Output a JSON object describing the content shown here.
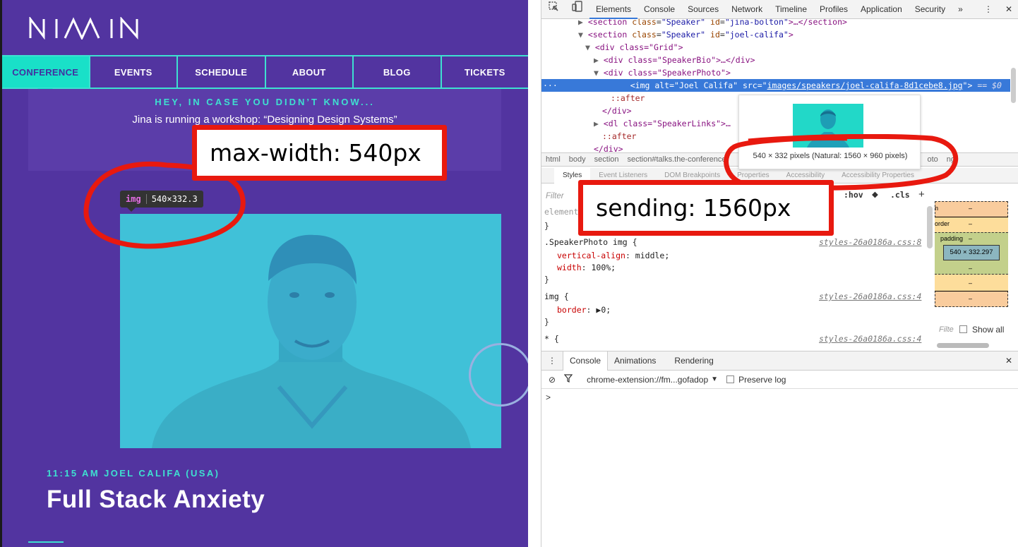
{
  "site": {
    "logo_text": "MIXIN",
    "nav": [
      "CONFERENCE",
      "EVENTS",
      "SCHEDULE",
      "ABOUT",
      "BLOG",
      "TICKETS"
    ],
    "notice_kicker": "HEY, IN CASE YOU DIDN’T KNOW...",
    "notice_text": "Jina is running a workshop: “Designing Design Systems”",
    "img_tip_tag": "img",
    "img_tip_dims": "540×332.3",
    "talk_meta": "11:15 AM JOEL CALIFA (USA)",
    "talk_title": "Full Stack Anxiety"
  },
  "annotations": {
    "max_width": "max-width: 540px",
    "sending": "sending: 1560px"
  },
  "devtools": {
    "tabs": [
      "Elements",
      "Console",
      "Sources",
      "Network",
      "Timeline",
      "Profiles",
      "Application",
      "Security"
    ],
    "more": "»",
    "dom": {
      "l1_tag": "<section",
      "l1_attr1": "class",
      "l1_val1": "\"Speaker\"",
      "l1_attr2": "id",
      "l1_val2": "\"jina-bolton\"",
      "l1_tail": ">…</section>",
      "l2_tag": "<section",
      "l2_attr1": "class",
      "l2_val1": "\"Speaker\"",
      "l2_attr2": "id",
      "l2_val2": "\"joel-califa\"",
      "l2_tail": ">",
      "l3": "<div class=\"Grid\">",
      "l4": "<div class=\"SpeakerBio\">…</div>",
      "l5": "<div class=\"SpeakerPhoto\">",
      "l6_pre": "<img alt=\"Joel Califa\" src=\"",
      "l6_src": "images/speakers/joel-califa-8d1cebe8.jpg",
      "l6_post": "\">",
      "l6_eq": "== $0",
      "l6_dots": "···",
      "l7": "::after",
      "l8": "</div>",
      "l9": "<dl class=\"SpeakerLinks\">…",
      "l10": "::after",
      "l11": "</div>"
    },
    "preview_dims": "540 × 332 pixels (Natural: 1560 × 960 pixels)",
    "breadcrumbs": [
      "html",
      "body",
      "section",
      "section#talks.the-conference",
      "oto",
      "ng"
    ],
    "sub_tabs": [
      "Styles",
      "Event Listeners",
      "DOM Breakpoints",
      "Properties",
      "Accessibility",
      "Accessibility Properties"
    ],
    "filter_placeholder": "Filter",
    "hov": ":hov",
    "cls": ".cls",
    "plus": "+",
    "styles": {
      "element_label": "element",
      "close1": "}",
      "rule1_selector": ".SpeakerPhoto img {",
      "rule1_src": "styles-26a0186a.css:8",
      "rule1_p1": "vertical-align",
      "rule1_v1": "middle;",
      "rule1_p2": "width",
      "rule1_v2": "100%;",
      "close2": "}",
      "rule2_selector": "img {",
      "rule2_src": "styles-26a0186a.css:4",
      "rule2_p1": "border",
      "rule2_v1": "▶0;",
      "close3": "}",
      "rule3_selector": "* {",
      "rule3_src": "styles-26a0186a.css:4"
    },
    "boxmodel": {
      "margin_label": "n",
      "margin_val": "–",
      "border_label": "order",
      "border_val": "–",
      "padding_label": "padding",
      "padding_val": "–",
      "content": "540 × 332.297",
      "bottom_dash1": "–",
      "bottom_dash2": "–",
      "bottom_dash3": "–"
    },
    "show_all_filter": "Filte",
    "show_all": "Show all",
    "console_tabs": [
      "Console",
      "Animations",
      "Rendering"
    ],
    "context": "chrome-extension://fm...gofadop",
    "preserve_log": "Preserve log",
    "prompt": ">"
  }
}
